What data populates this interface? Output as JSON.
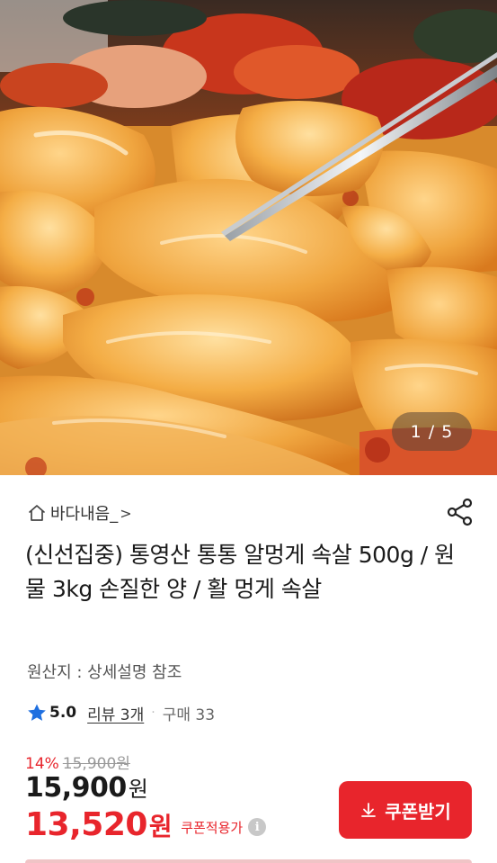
{
  "gallery": {
    "current": "1",
    "total": "5",
    "pager_text": "1 / 5"
  },
  "store": {
    "name": "바다내음_",
    "chevron": ">"
  },
  "product": {
    "title": "(신선집중) 통영산 통통 알멍게 속살 500g / 원물 3kg 손질한 양 / 활 멍게 속살",
    "origin": "원산지 : 상세설명 참조"
  },
  "rating": {
    "score": "5.0",
    "review_label": "리뷰 3개",
    "separator": "·",
    "purchase_label": "구매 33"
  },
  "price": {
    "discount_rate": "14%",
    "original": "15,900",
    "original_unit": "원",
    "sale": "15,900",
    "sale_unit": "원",
    "coupon_price": "13,520",
    "coupon_unit": "원",
    "coupon_applied_label": "쿠폰적용가",
    "info_symbol": "i"
  },
  "actions": {
    "coupon_button": "쿠폰받기"
  },
  "colors": {
    "accent_red": "#e8252c",
    "star_blue": "#1e6fe0",
    "text_dark": "#1a1a1a",
    "text_muted": "#999999"
  },
  "icons": {
    "home": "home-icon",
    "share": "share-icon",
    "star": "star-icon",
    "info": "info-icon",
    "download": "download-icon"
  }
}
